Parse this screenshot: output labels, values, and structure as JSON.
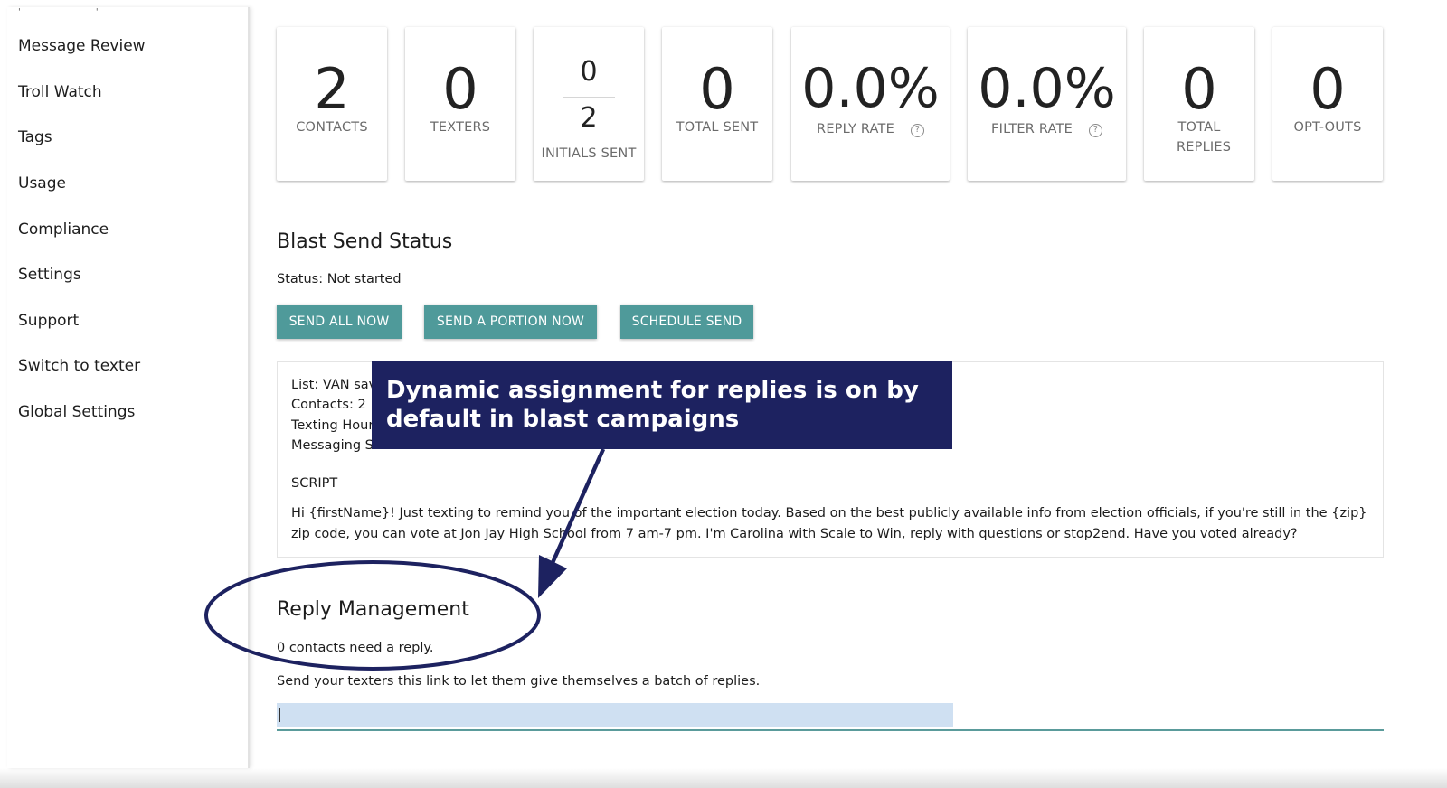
{
  "sidebar": {
    "items": [
      {
        "label": "Message Review"
      },
      {
        "label": "Troll Watch"
      },
      {
        "label": "Tags"
      },
      {
        "label": "Usage"
      },
      {
        "label": "Compliance"
      },
      {
        "label": "Settings"
      },
      {
        "label": "Support"
      },
      {
        "label": "Switch to texter"
      },
      {
        "label": "Global Settings"
      }
    ]
  },
  "stats": {
    "contacts": {
      "value": "2",
      "label": "CONTACTS"
    },
    "texters": {
      "value": "0",
      "label": "TEXTERS"
    },
    "initials": {
      "top": "0",
      "bottom": "2",
      "label": "INITIALS SENT"
    },
    "total_sent": {
      "value": "0",
      "label": "TOTAL SENT"
    },
    "reply_rate": {
      "value": "0.0%",
      "label": "REPLY RATE"
    },
    "filter_rate": {
      "value": "0.0%",
      "label": "FILTER RATE"
    },
    "total_replies": {
      "value": "0",
      "label": "TOTAL REPLIES"
    },
    "opt_outs": {
      "value": "0",
      "label": "OPT-OUTS"
    }
  },
  "blast": {
    "title": "Blast Send Status",
    "status": "Status: Not started",
    "buttons": {
      "send_all": "SEND ALL NOW",
      "send_portion": "SEND A PORTION NOW",
      "schedule": "SCHEDULE SEND"
    }
  },
  "info": {
    "list": "List: VAN sav",
    "contacts": "Contacts: 2",
    "hours": "Texting Hour",
    "strategy": "Messaging S",
    "script_heading": "SCRIPT",
    "script_text": "Hi {firstName}! Just texting to remind you of the important election today. Based on the best publicly available info from election officials, if you're still in the {zip} zip code, you can vote at Jon Jay High School from 7 am-7 pm. I'm Carolina with Scale to Win, reply with questions or stop2end. Have you voted already?"
  },
  "callout": {
    "text": "Dynamic assignment for replies is on by default in blast campaigns"
  },
  "reply": {
    "title": "Reply Management",
    "need_reply": "0 contacts need a reply.",
    "link_instructions": "Send your texters this link to let them give themselves a batch of replies."
  },
  "colors": {
    "button": "#4f9a9a",
    "callout_bg": "#1d2260",
    "annotation": "#1d2260",
    "link_highlight": "#cfe0f2"
  }
}
